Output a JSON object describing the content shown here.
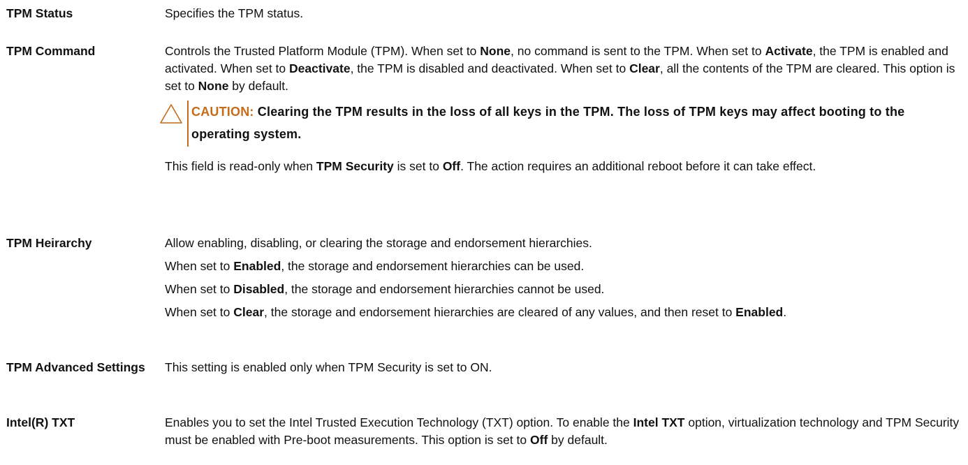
{
  "entries": [
    {
      "term": "TPM Status",
      "paragraphs": [
        [
          {
            "t": "Specifies the TPM status."
          }
        ]
      ]
    },
    {
      "term": "TPM Command",
      "paragraphs": [
        [
          {
            "t": "Controls the Trusted Platform Module (TPM). When set to "
          },
          {
            "t": "None",
            "b": true
          },
          {
            "t": ", no command is sent to the TPM. When set to "
          },
          {
            "t": "Activate",
            "b": true
          },
          {
            "t": ", the TPM is enabled and activated. When set to "
          },
          {
            "t": "Deactivate",
            "b": true
          },
          {
            "t": ", the TPM is disabled and deactivated. When set to "
          },
          {
            "t": "Clear",
            "b": true
          },
          {
            "t": ", all the contents of the TPM are cleared. This option is set to "
          },
          {
            "t": "None",
            "b": true
          },
          {
            "t": " by default."
          }
        ]
      ],
      "caution": {
        "label": "CAUTION:",
        "text": "Clearing the TPM results in the loss of all keys in the TPM. The loss of TPM keys may affect booting to the operating system.",
        "icon": "warning-triangle-icon",
        "accent_color": "#c56b1a"
      },
      "after_paragraphs": [
        [
          {
            "t": "This field is read-only when "
          },
          {
            "t": "TPM Security",
            "b": true
          },
          {
            "t": " is set to "
          },
          {
            "t": "Off",
            "b": true
          },
          {
            "t": ". The action requires an additional reboot before it can take effect."
          }
        ]
      ]
    },
    {
      "term": "TPM Heirarchy",
      "paragraphs": [
        [
          {
            "t": "Allow enabling, disabling, or clearing the storage and endorsement hierarchies."
          }
        ],
        [
          {
            "t": "When set to "
          },
          {
            "t": "Enabled",
            "b": true
          },
          {
            "t": ", the storage and endorsement hierarchies can be used."
          }
        ],
        [
          {
            "t": "When set to "
          },
          {
            "t": "Disabled",
            "b": true
          },
          {
            "t": ", the storage and endorsement hierarchies cannot be used."
          }
        ],
        [
          {
            "t": "When set to "
          },
          {
            "t": "Clear",
            "b": true
          },
          {
            "t": ", the storage and endorsement hierarchies are cleared of any values, and then reset to "
          },
          {
            "t": "Enabled",
            "b": true
          },
          {
            "t": "."
          }
        ]
      ]
    },
    {
      "term": "TPM Advanced Settings",
      "paragraphs": [
        [
          {
            "t": "This setting is enabled only when TPM Security is set to ON."
          }
        ]
      ]
    },
    {
      "term": "Intel(R) TXT",
      "paragraphs": [
        [
          {
            "t": "Enables you to set the Intel Trusted Execution Technology (TXT) option. To enable the "
          },
          {
            "t": "Intel TXT",
            "b": true
          },
          {
            "t": " option, virtualization technology and TPM Security must be enabled with Pre-boot measurements. This option is set to "
          },
          {
            "t": "Off",
            "b": true
          },
          {
            "t": " by default."
          }
        ]
      ]
    }
  ]
}
